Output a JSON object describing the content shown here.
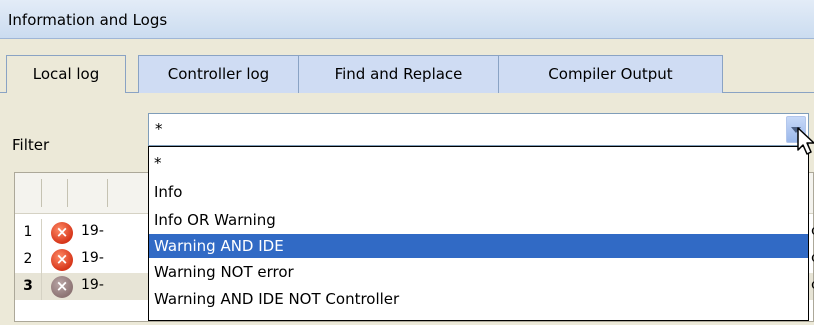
{
  "panel": {
    "title": "Information and Logs"
  },
  "tabs": [
    {
      "label": "Local log",
      "active": true
    },
    {
      "label": "Controller log",
      "active": false
    },
    {
      "label": "Find and Replace",
      "active": false
    },
    {
      "label": "Compiler Output",
      "active": false
    }
  ],
  "filter": {
    "label": "Filter",
    "value": "*",
    "options": [
      "*",
      "Info",
      "Info OR Warning",
      "Warning AND IDE",
      "Warning NOT error",
      "Warning AND IDE NOT Controller"
    ],
    "highlighted": "Warning AND IDE"
  },
  "log": {
    "rows": [
      {
        "num": "1",
        "icon": "error-icon",
        "text": "19-",
        "tail": "c"
      },
      {
        "num": "2",
        "icon": "error-icon",
        "text": "19-",
        "tail": "c"
      },
      {
        "num": "3",
        "icon": "error-icon",
        "text": "19-",
        "tail": "c"
      }
    ]
  },
  "colors": {
    "highlight": "#316ac5",
    "error": "#d6361a",
    "tabActive": "#ece9d8",
    "tabInactive": "#cfdcf3"
  },
  "icons": {
    "combo_arrow": "chevron-down-icon",
    "cursor": "mouse-pointer-icon"
  }
}
